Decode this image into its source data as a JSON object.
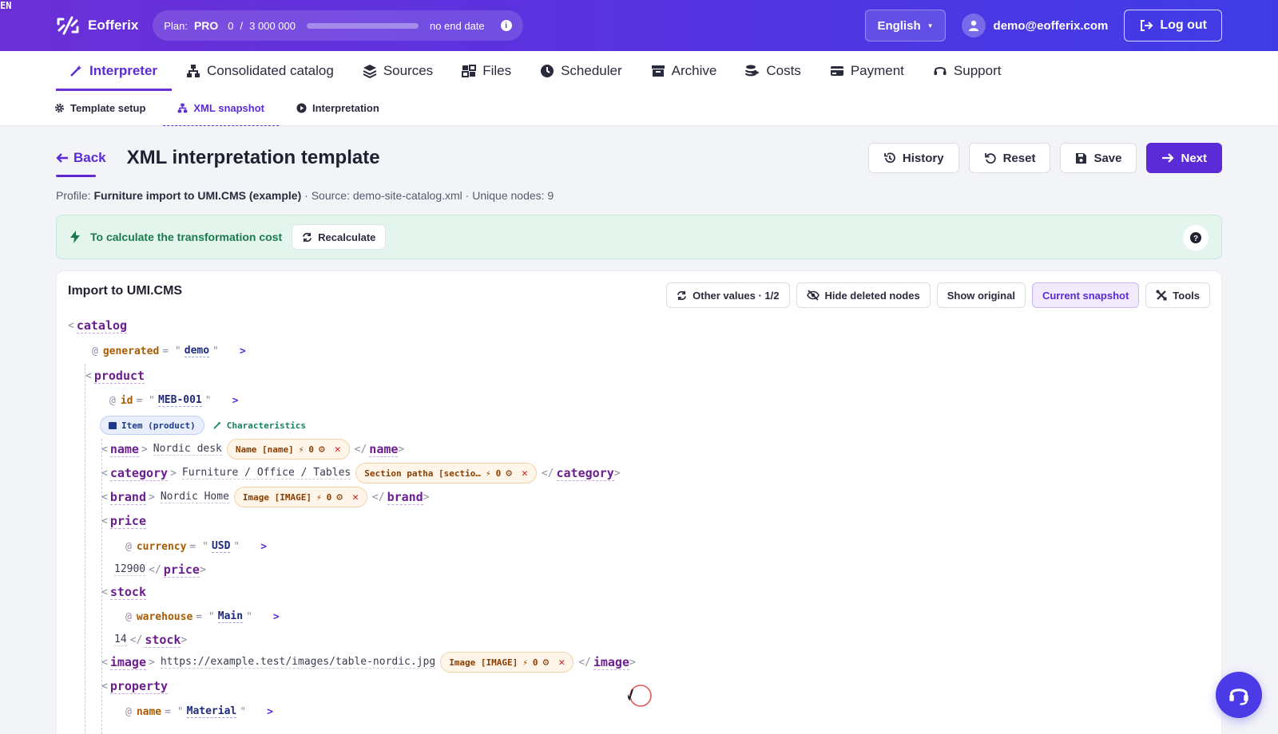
{
  "brand": {
    "name": "Eofferix"
  },
  "plan": {
    "label": "Plan:",
    "tier": "PRO",
    "used": "0",
    "sep": "/",
    "limit": "3 000 000",
    "period": "no end date",
    "usage_fraction": 0
  },
  "lang": {
    "code": "EN",
    "name": "English"
  },
  "user": {
    "email": "demo@eofferix.com",
    "logout": "Log out"
  },
  "nav": {
    "items": [
      "Interpreter",
      "Consolidated catalog",
      "Sources",
      "Files",
      "Scheduler",
      "Archive",
      "Costs",
      "Payment",
      "Support"
    ]
  },
  "subnav": {
    "items": [
      "Template setup",
      "XML snapshot",
      "Interpretation"
    ]
  },
  "header": {
    "back": "Back",
    "title": "XML interpretation template",
    "history": "History",
    "reset": "Reset",
    "save": "Save",
    "next": "Next"
  },
  "profile": {
    "label": "Profile:",
    "name": "Furniture import to UMI.CMS (example)",
    "source": " · Source: demo-site-catalog.xml",
    "nodes": " · Unique nodes: 9"
  },
  "alert": {
    "text": "To calculate the transformation cost",
    "button": "Recalculate"
  },
  "panel": {
    "title": "Import to UMI.CMS",
    "other": "Other values · 1/2",
    "hide": "Hide deleted nodes",
    "original": "Show original",
    "current": "Current snapshot",
    "tools": "Tools"
  },
  "xml": {
    "catalog": "catalog",
    "generated_attr": "generated",
    "generated_val": "demo",
    "product": "product",
    "id_attr": "id",
    "id_val": "MEB-001",
    "item_pill": "Item (product)",
    "char_pill": "Characteristics",
    "name_tag": "name",
    "name_val": "Nordic desk",
    "name_chip": "Name [name]",
    "name_count": "0",
    "category_tag": "category",
    "category_val": "Furniture / Office / Tables",
    "category_chip": "Section patha [sectio…",
    "category_count": "0",
    "brand_tag": "brand",
    "brand_val": "Nordic Home",
    "brand_chip": "Image [IMAGE]",
    "brand_count": "0",
    "price_tag": "price",
    "currency_attr": "currency",
    "currency_val": "USD",
    "price_val": "12900",
    "stock_tag": "stock",
    "warehouse_attr": "warehouse",
    "warehouse_val": "Main",
    "stock_val": "14",
    "image_tag": "image",
    "image_val": "https://example.test/images/table-nordic.jpg",
    "image_chip": "Image [IMAGE]",
    "image_count": "0",
    "property_tag": "property",
    "pname_attr": "name",
    "pname_val": "Material"
  },
  "colors": {
    "accent": "#5b2bd8",
    "success_bg": "#e4f5ee",
    "chip_bg": "#fff6e9"
  }
}
